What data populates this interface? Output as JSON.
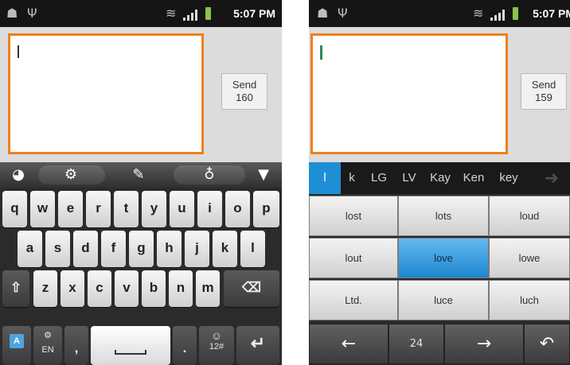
{
  "colors": {
    "accent_orange": "#f07f1a",
    "highlight_blue": "#1e8fd6"
  },
  "left": {
    "status": {
      "time": "5:07 PM",
      "icons": [
        "android-icon",
        "usb-icon",
        "wifi-icon",
        "signal-icon",
        "battery-icon"
      ]
    },
    "compose": {
      "send_label": "Send",
      "send_count": "160"
    },
    "toolbar": [
      "emoji-handle-icon",
      "gear-icon",
      "edit-icon",
      "mic-icon",
      "hide-keyboard-icon"
    ],
    "keyboard": {
      "row1": [
        "q",
        "w",
        "e",
        "r",
        "t",
        "y",
        "u",
        "i",
        "o",
        "p"
      ],
      "row2": [
        "a",
        "s",
        "d",
        "f",
        "g",
        "h",
        "j",
        "k",
        "l"
      ],
      "row3": [
        "⇧",
        "z",
        "x",
        "c",
        "v",
        "b",
        "n",
        "m",
        "⌫"
      ],
      "bottom": {
        "lang": "EN",
        "comma": ",",
        "period": ".",
        "sym": "12#",
        "enter": "↵"
      }
    }
  },
  "right": {
    "status": {
      "time": "5:07 PM"
    },
    "compose": {
      "send_label": "Send",
      "send_count": "159"
    },
    "suggestions": [
      "l",
      "k",
      "LG",
      "LV",
      "Kay",
      "Ken",
      "key"
    ],
    "grid": [
      [
        "lost",
        "lots",
        "loud"
      ],
      [
        "lout",
        "love",
        "lowe"
      ],
      [
        "Ltd.",
        "luce",
        "luch"
      ]
    ],
    "selected": "love",
    "nav": {
      "left": "←",
      "count": "24",
      "right": "→",
      "undo": "↶"
    }
  }
}
